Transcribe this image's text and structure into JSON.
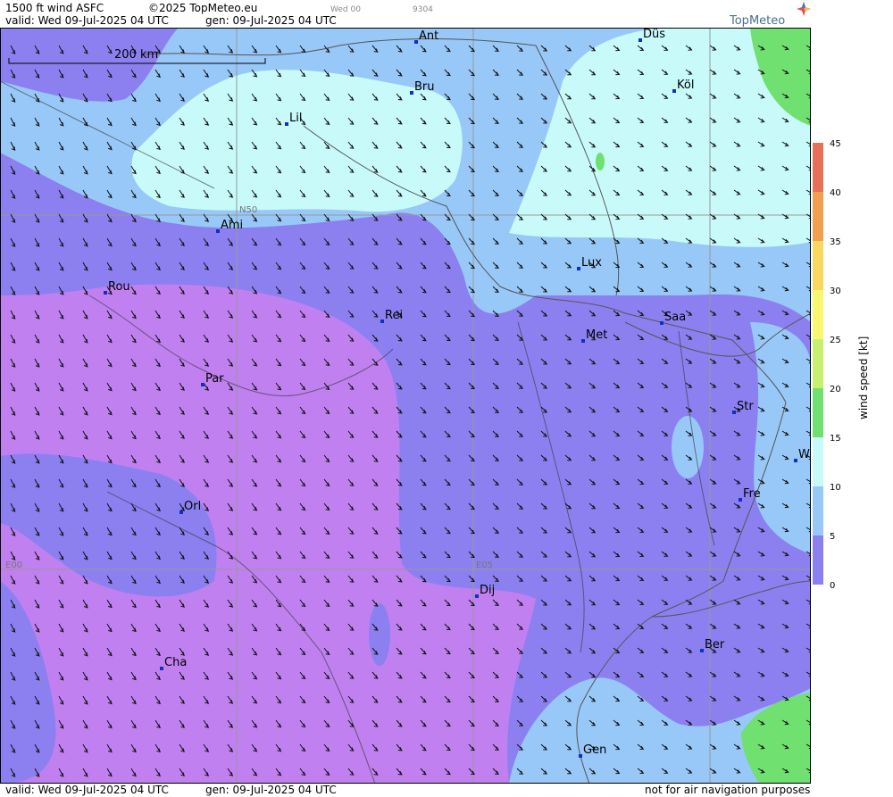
{
  "header": {
    "title": "1500 ft wind ASFC",
    "copyright": "©2025 TopMeteo.eu",
    "mini_day": "Wed 00",
    "mini_code": "9304",
    "valid": "valid:  Wed  09-Jul-2025  04 UTC",
    "gen": "gen: 09-Jul-2025 04 UTC"
  },
  "logo": {
    "text": "TopMeteo",
    "icon": "compass-star-icon"
  },
  "scale_bar": {
    "label": "200 km"
  },
  "grid_labels": {
    "lat": "N50",
    "lon0": "E00",
    "lon5": "E05"
  },
  "cities": [
    {
      "name": "Ant"
    },
    {
      "name": "Düs"
    },
    {
      "name": "Köl"
    },
    {
      "name": "Bru"
    },
    {
      "name": "Lil"
    },
    {
      "name": "Ami"
    },
    {
      "name": "Lux"
    },
    {
      "name": "Rou"
    },
    {
      "name": "Rei"
    },
    {
      "name": "Saa"
    },
    {
      "name": "Met"
    },
    {
      "name": "Par"
    },
    {
      "name": "Str"
    },
    {
      "name": "W"
    },
    {
      "name": "Fre"
    },
    {
      "name": "Orl"
    },
    {
      "name": "Dij"
    },
    {
      "name": "Ber"
    },
    {
      "name": "Cha"
    },
    {
      "name": "Gen"
    }
  ],
  "legend": {
    "title": "wind speed [kt]",
    "ticks": [
      "45",
      "40",
      "35",
      "30",
      "25",
      "20",
      "15",
      "10",
      "5",
      "0"
    ],
    "colors": [
      "#e8705a",
      "#f0a050",
      "#f8d860",
      "#f8f870",
      "#c8f070",
      "#70e070",
      "#c8fafa",
      "#98c8f8",
      "#8c80f0",
      "#c080f0"
    ]
  },
  "footer": {
    "valid": "valid:  Wed  09-Jul-2025  04 UTC",
    "gen": "gen: 09-Jul-2025 04 UTC",
    "note": "not for air navigation purposes"
  }
}
